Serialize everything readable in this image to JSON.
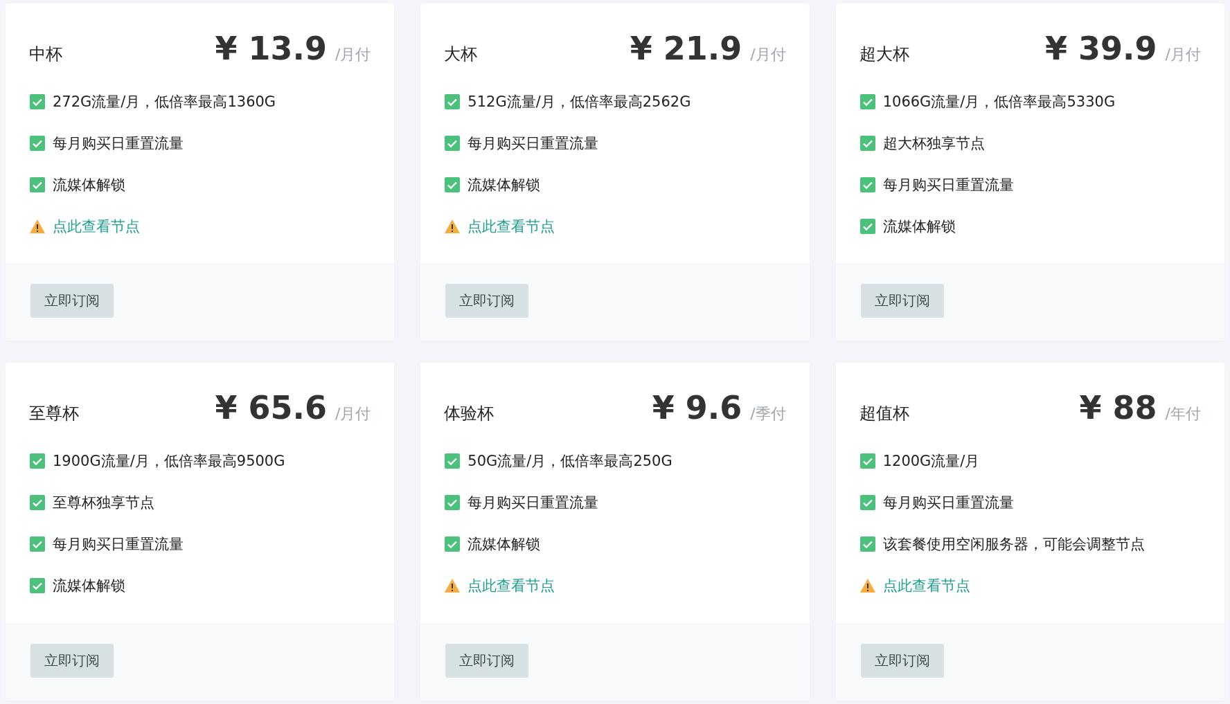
{
  "plans": [
    {
      "name": "中杯",
      "price": "¥ 13.9",
      "period": "/月付",
      "features": [
        {
          "kind": "check",
          "text": "272G流量/月，低倍率最高1360G"
        },
        {
          "kind": "check",
          "text": "每月购买日重置流量"
        },
        {
          "kind": "check",
          "text": "流媒体解锁"
        },
        {
          "kind": "link",
          "text": "点此查看节点"
        }
      ],
      "button": "立即订阅"
    },
    {
      "name": "大杯",
      "price": "¥ 21.9",
      "period": "/月付",
      "features": [
        {
          "kind": "check",
          "text": "512G流量/月，低倍率最高2562G"
        },
        {
          "kind": "check",
          "text": "每月购买日重置流量"
        },
        {
          "kind": "check",
          "text": "流媒体解锁"
        },
        {
          "kind": "link",
          "text": "点此查看节点"
        }
      ],
      "button": "立即订阅"
    },
    {
      "name": "超大杯",
      "price": "¥ 39.9",
      "period": "/月付",
      "features": [
        {
          "kind": "check",
          "text": "1066G流量/月，低倍率最高5330G"
        },
        {
          "kind": "check",
          "text": "超大杯独享节点"
        },
        {
          "kind": "check",
          "text": "每月购买日重置流量"
        },
        {
          "kind": "check",
          "text": "流媒体解锁"
        }
      ],
      "button": "立即订阅"
    },
    {
      "name": "至尊杯",
      "price": "¥ 65.6",
      "period": "/月付",
      "features": [
        {
          "kind": "check",
          "text": "1900G流量/月，低倍率最高9500G"
        },
        {
          "kind": "check",
          "text": "至尊杯独享节点"
        },
        {
          "kind": "check",
          "text": "每月购买日重置流量"
        },
        {
          "kind": "check",
          "text": "流媒体解锁"
        }
      ],
      "button": "立即订阅"
    },
    {
      "name": "体验杯",
      "price": "¥ 9.6",
      "period": "/季付",
      "features": [
        {
          "kind": "check",
          "text": "50G流量/月，低倍率最高250G"
        },
        {
          "kind": "check",
          "text": "每月购买日重置流量"
        },
        {
          "kind": "check",
          "text": "流媒体解锁"
        },
        {
          "kind": "link",
          "text": "点此查看节点"
        }
      ],
      "button": "立即订阅"
    },
    {
      "name": "超值杯",
      "price": "¥ 88",
      "period": "/年付",
      "features": [
        {
          "kind": "check",
          "text": "1200G流量/月"
        },
        {
          "kind": "check",
          "text": "每月购买日重置流量"
        },
        {
          "kind": "check",
          "text": "该套餐使用空闲服务器，可能会调整节点"
        },
        {
          "kind": "link",
          "text": "点此查看节点"
        }
      ],
      "button": "立即订阅"
    }
  ]
}
